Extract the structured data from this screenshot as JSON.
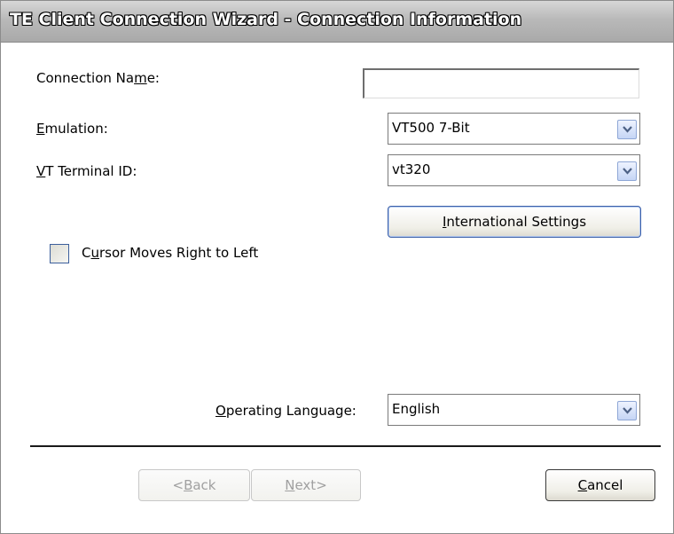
{
  "window": {
    "title": "TE Client Connection Wizard - Connection Information"
  },
  "form": {
    "connection_name": {
      "label_pre": "Connection Na",
      "label_ul": "m",
      "label_post": "e:",
      "value": ""
    },
    "emulation": {
      "label_ul": "E",
      "label_post": "mulation:",
      "selected": "VT500 7-Bit"
    },
    "vt_terminal_id": {
      "label_ul": "V",
      "label_post": "T Terminal ID:",
      "selected": "vt320"
    },
    "international_settings": {
      "label_ul": "I",
      "label_post": "nternational Settings"
    },
    "cursor_rtl": {
      "label_pre": "C",
      "label_ul": "u",
      "label_post": "rsor Moves Right to Left",
      "checked": false
    },
    "operating_language": {
      "label_ul": "O",
      "label_post": "perating Language:",
      "selected": "English"
    }
  },
  "buttons": {
    "back": {
      "pre": "<",
      "ul": "B",
      "post": "ack",
      "enabled": false
    },
    "next": {
      "ul": "N",
      "post": "ext>",
      "enabled": false
    },
    "cancel": {
      "ul": "C",
      "post": "ancel",
      "enabled": true
    }
  },
  "icons": {
    "dropdown": "chevron-down-icon",
    "checkbox": "checkbox-unchecked"
  },
  "colors": {
    "title_bar": "#b9b9b9",
    "dropdown_arrow": "#3a5fa8",
    "focus_border": "#3b5fa8"
  }
}
